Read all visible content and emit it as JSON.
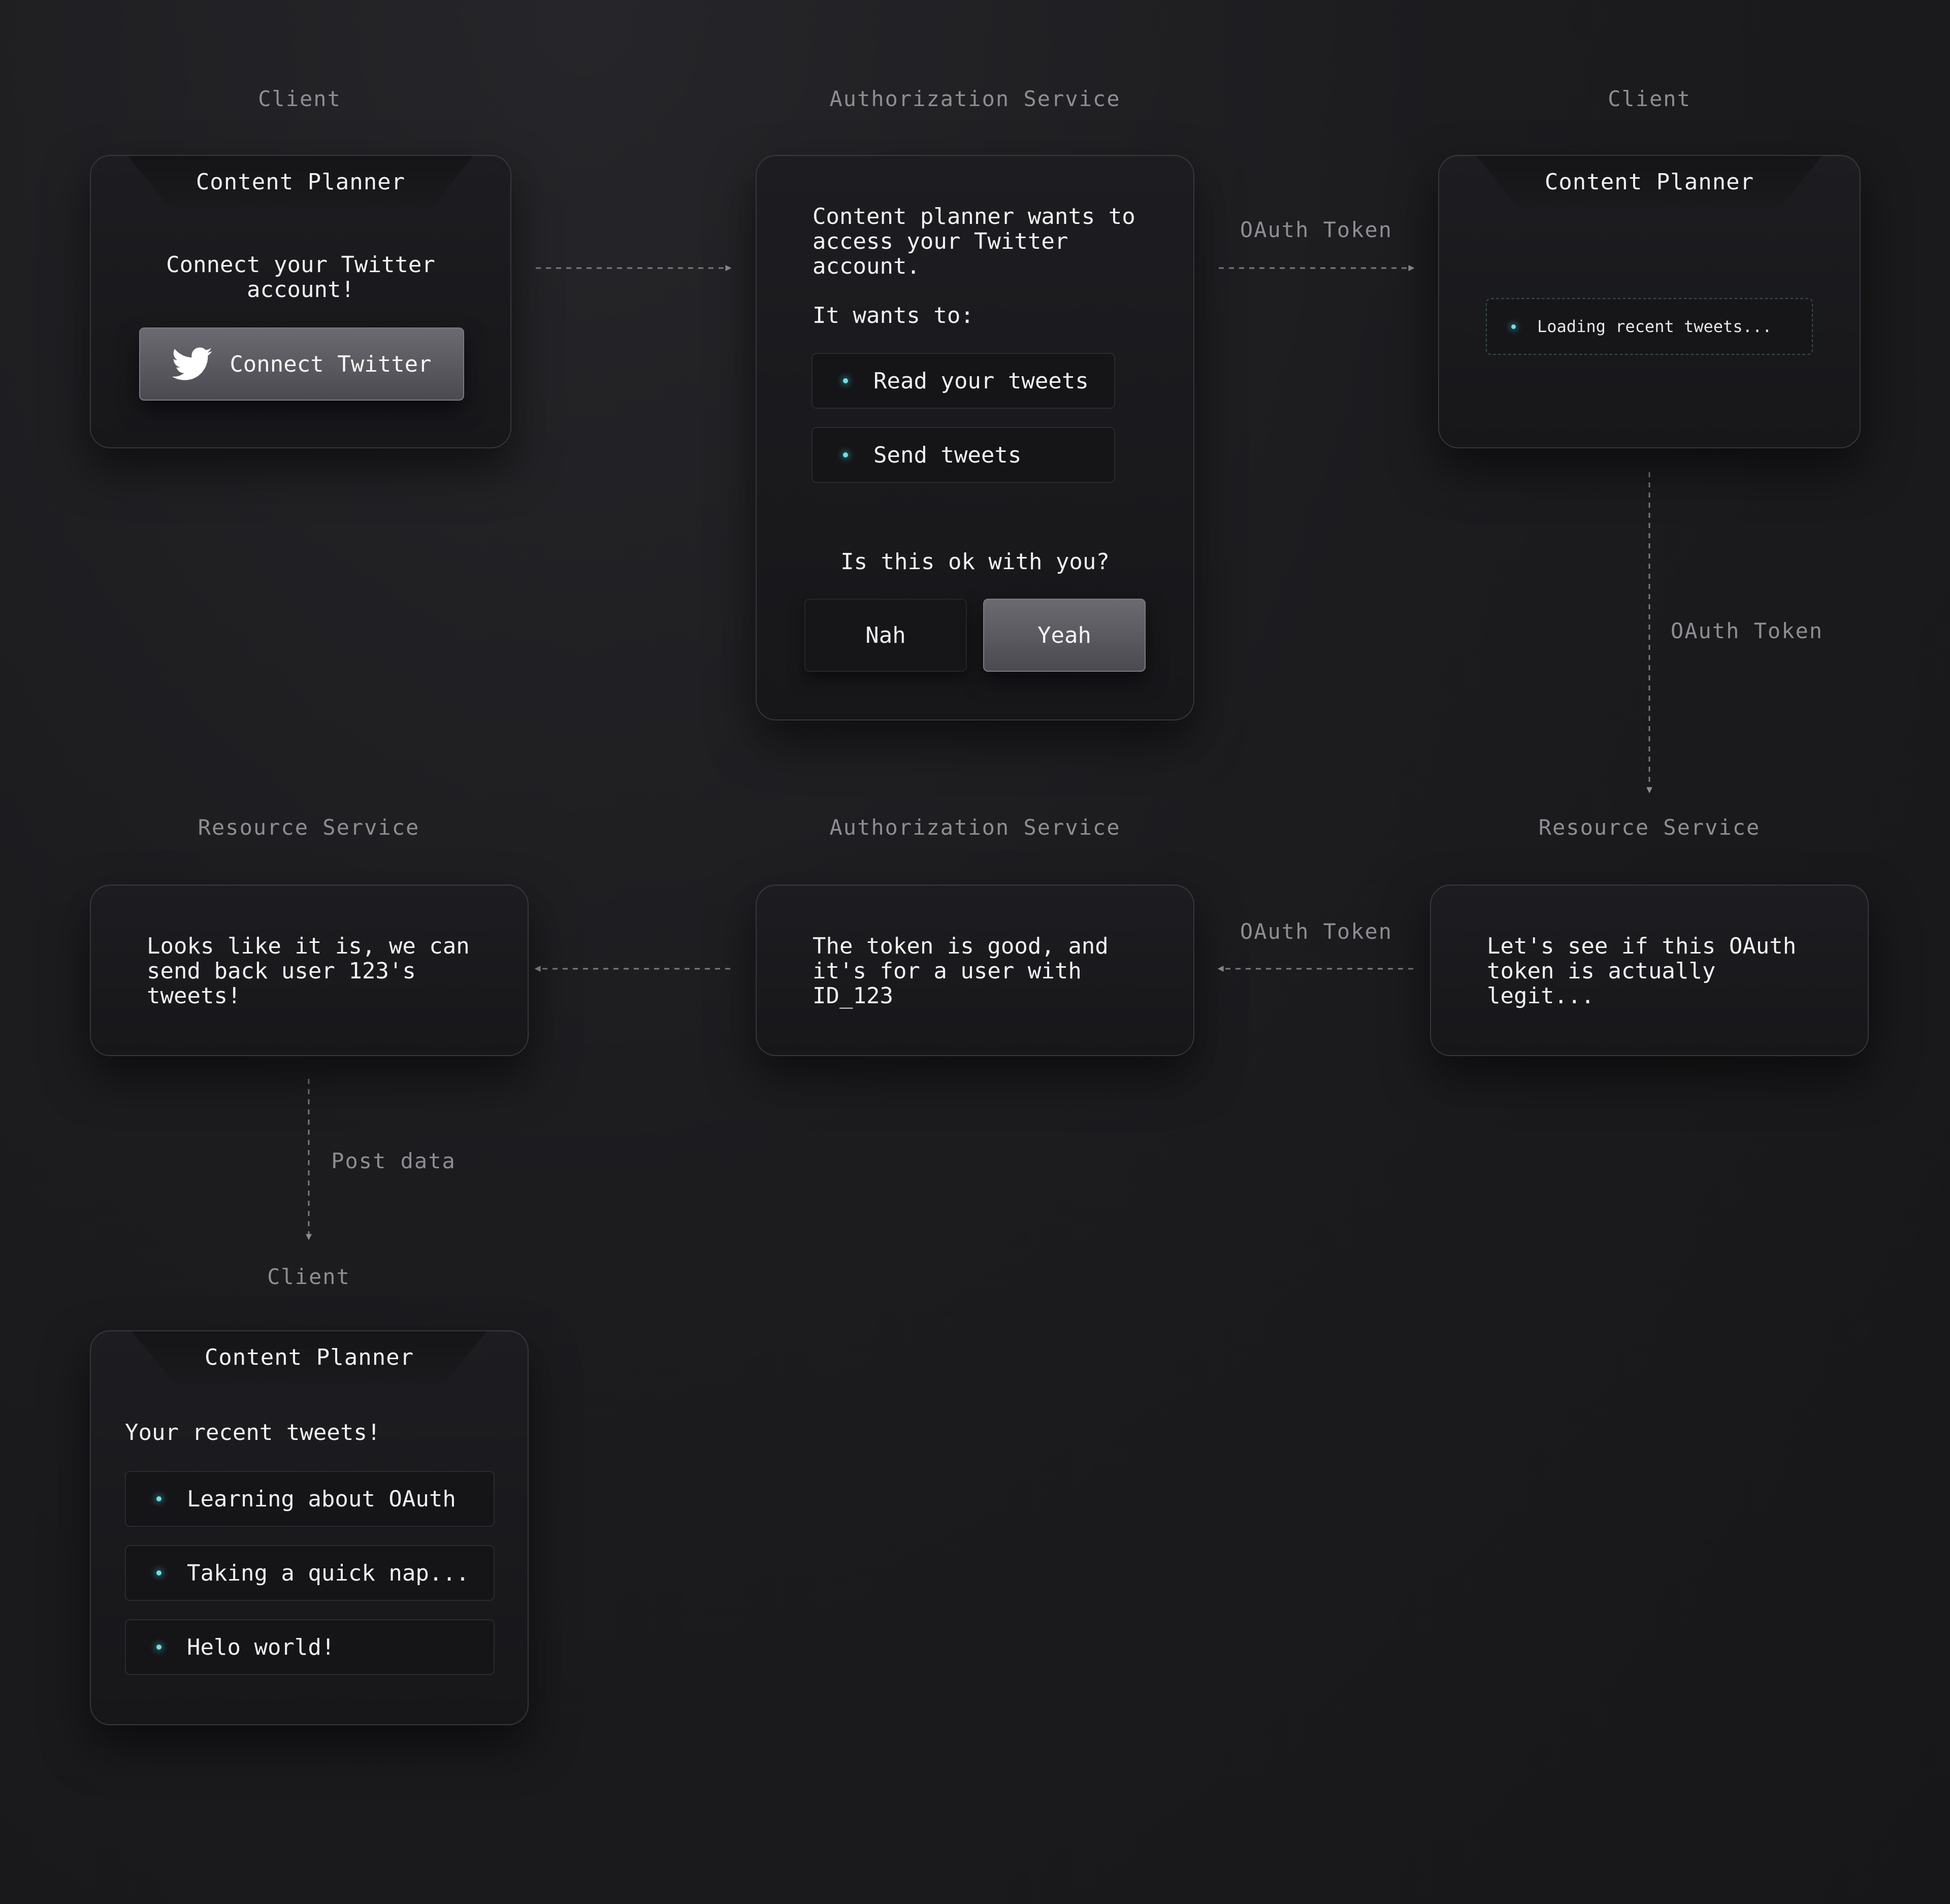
{
  "labels": {
    "client_1": "Client",
    "auth_1": "Authorization Service",
    "client_2": "Client",
    "resource_1": "Resource Service",
    "auth_2": "Authorization Service",
    "resource_2": "Resource Service",
    "client_3": "Client"
  },
  "edges": {
    "oauth_token_1": "OAuth Token",
    "oauth_token_2": "OAuth Token",
    "oauth_token_3": "OAuth Token",
    "post_data": "Post data"
  },
  "card_client_1": {
    "tab_title": "Content Planner",
    "message": "Connect your Twitter\naccount!",
    "button_label": "Connect Twitter",
    "button_icon": "twitter-bird-icon"
  },
  "card_auth_1": {
    "intro": "Content planner wants to\naccess your Twitter\naccount.",
    "wants_label": "It wants to:",
    "scopes": [
      "Read your tweets",
      "Send tweets"
    ],
    "question": "Is this ok with you?",
    "deny_label": "Nah",
    "approve_label": "Yeah"
  },
  "card_client_2": {
    "tab_title": "Content Planner",
    "loading_text": "Loading recent tweets..."
  },
  "card_resource_1": {
    "message": "Looks like it is, we can\nsend back user 123's\ntweets!"
  },
  "card_auth_2": {
    "message": "The token is good, and\nit's for a user with\nID_123"
  },
  "card_resource_2": {
    "message": "Let's see if this OAuth\ntoken is actually\nlegit..."
  },
  "card_client_3": {
    "tab_title": "Content Planner",
    "heading": "Your recent tweets!",
    "tweets": [
      "Learning about OAuth",
      "Taking a quick nap...",
      "Helo world!"
    ]
  },
  "colors": {
    "background": "#1c1c1f",
    "accent_dot": "#6ee0e8",
    "label_gray": "#8d8d93"
  }
}
